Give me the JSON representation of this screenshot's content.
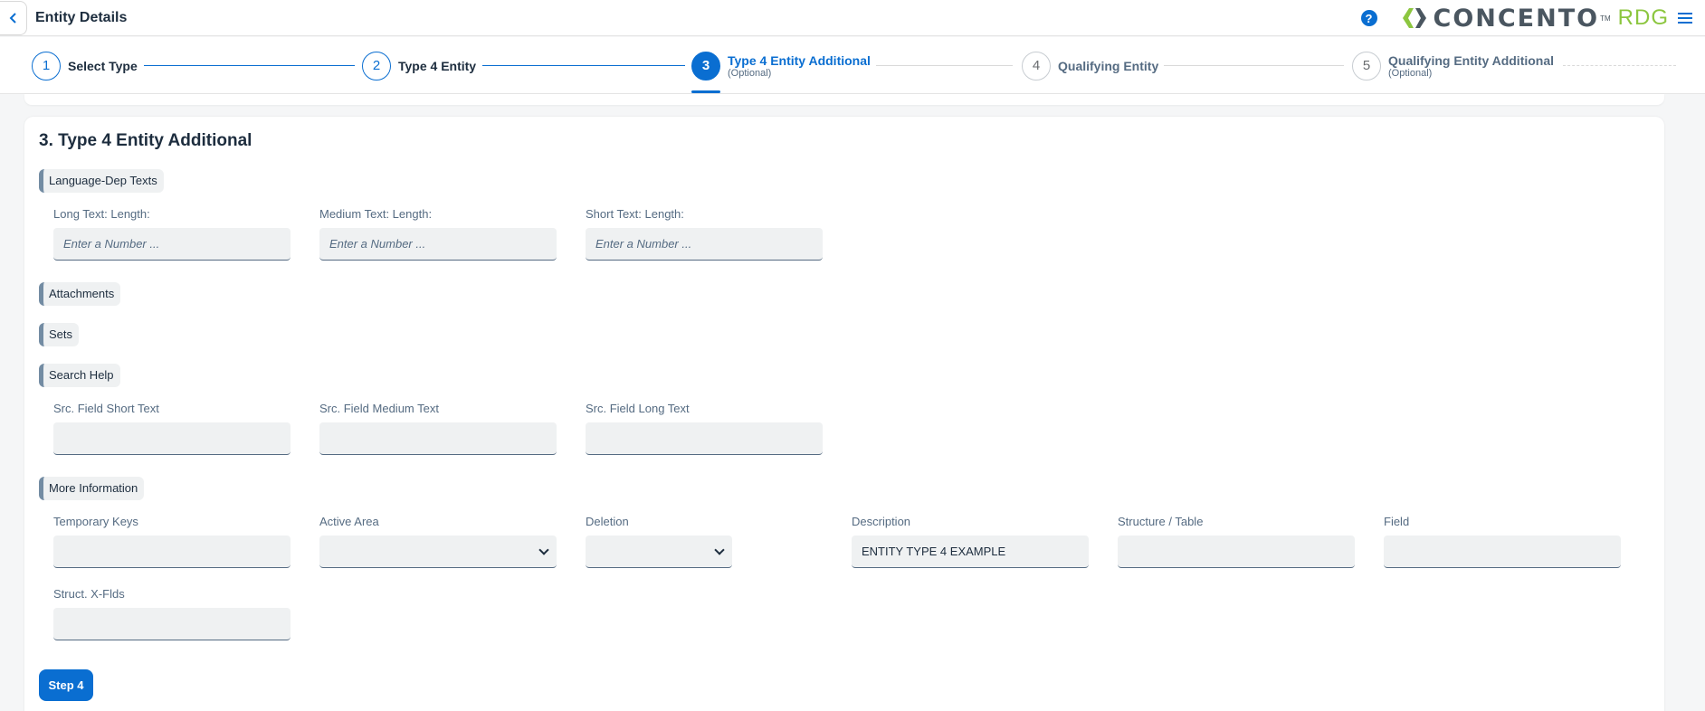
{
  "header": {
    "title": "Entity Details",
    "help": "?",
    "logo_text": "CONCENTO",
    "logo_tm": "TM",
    "logo_suffix": "RDG"
  },
  "wizard": {
    "steps": [
      {
        "number": "1",
        "label": "Select Type",
        "sub": ""
      },
      {
        "number": "2",
        "label": "Type 4 Entity",
        "sub": ""
      },
      {
        "number": "3",
        "label": "Type 4 Entity Additional",
        "sub": "(Optional)"
      },
      {
        "number": "4",
        "label": "Qualifying Entity",
        "sub": ""
      },
      {
        "number": "5",
        "label": "Qualifying Entity Additional",
        "sub": "(Optional)"
      }
    ]
  },
  "section": {
    "title": "3. Type 4 Entity Additional",
    "groups": {
      "language": "Language-Dep Texts",
      "attachments": "Attachments",
      "sets": "Sets",
      "search_help": "Search Help",
      "more_info": "More Information"
    },
    "fields": {
      "long_text_label": "Long Text: Length:",
      "medium_text_label": "Medium Text: Length:",
      "short_text_label": "Short Text: Length:",
      "number_placeholder": "Enter a Number ...",
      "src_short_label": "Src. Field Short Text",
      "src_medium_label": "Src. Field Medium Text",
      "src_long_label": "Src. Field Long Text",
      "temp_keys_label": "Temporary Keys",
      "active_area_label": "Active Area",
      "deletion_label": "Deletion",
      "description_label": "Description",
      "description_value": "ENTITY TYPE 4 EXAMPLE",
      "structure_label": "Structure / Table",
      "field_label": "Field",
      "struct_xflds_label": "Struct. X-Flds"
    },
    "button": "Step 4"
  }
}
